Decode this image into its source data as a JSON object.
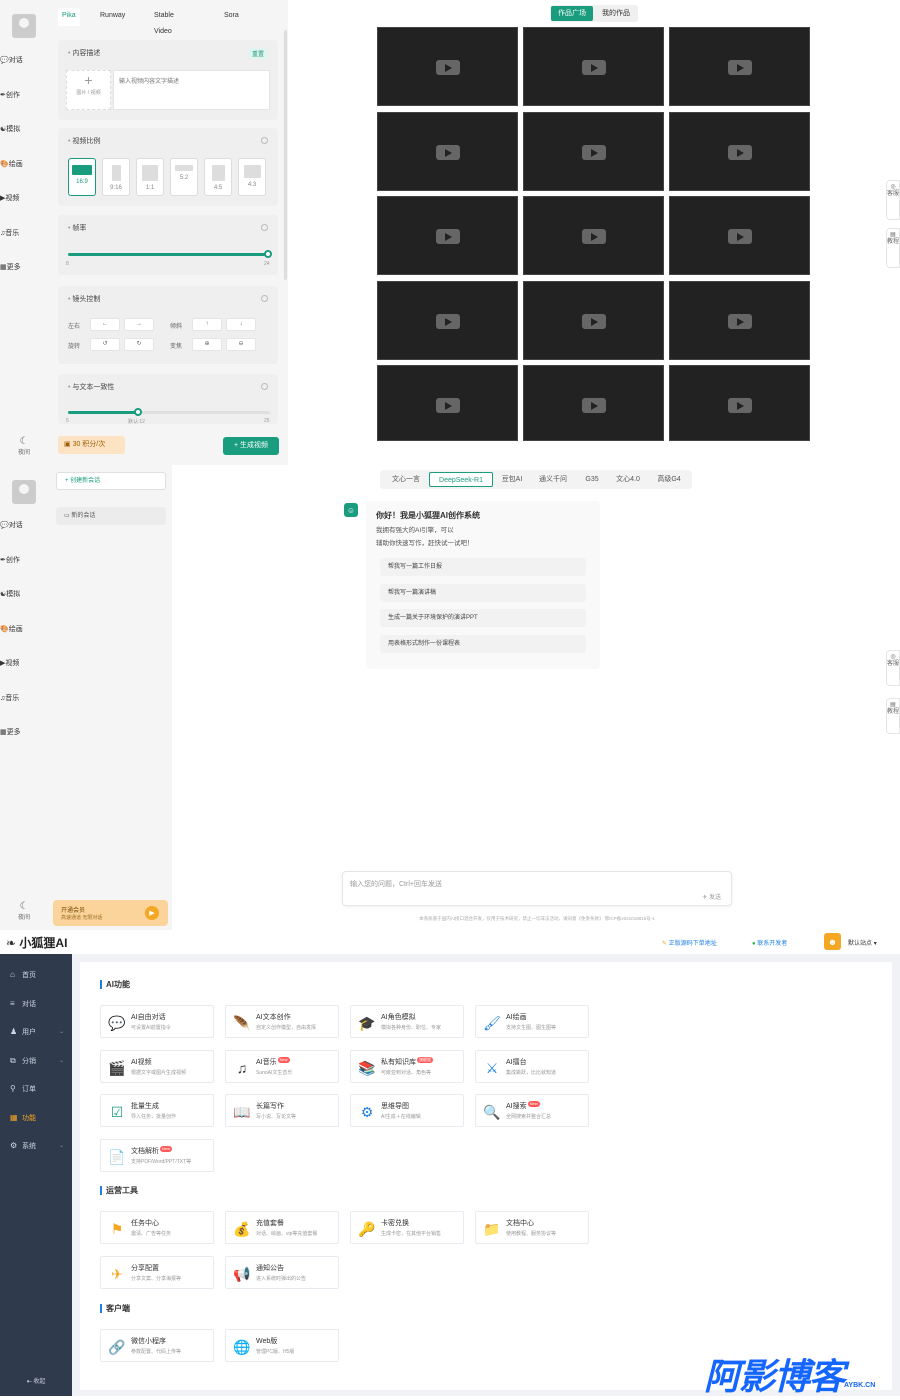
{
  "video_section": {
    "nav": [
      {
        "label": "对话",
        "icon": "chat-icon"
      },
      {
        "label": "创作",
        "icon": "feather-icon"
      },
      {
        "label": "模拟",
        "icon": "mask-icon"
      },
      {
        "label": "绘画",
        "icon": "palette-icon"
      },
      {
        "label": "视频",
        "icon": "video-icon"
      },
      {
        "label": "音乐",
        "icon": "music-icon"
      },
      {
        "label": "更多",
        "icon": "grid-icon"
      }
    ],
    "night_label": "夜间",
    "tabs": [
      "Pika",
      "Runway",
      "Stable Video",
      "Sora"
    ],
    "content_desc": {
      "title": "内容描述",
      "reset": "重置",
      "upload_label": "图片 / 视频",
      "placeholder": "输入视频内容文字描述"
    },
    "ratio": {
      "title": "视频比例",
      "options": [
        "16:9",
        "9:16",
        "1:1",
        "5:2",
        "4:5",
        "4:3"
      ]
    },
    "fps": {
      "title": "帧率",
      "min": "8",
      "max": "24",
      "value": 24
    },
    "camera": {
      "title": "镜头控制",
      "row1": [
        "左右",
        "倾斜"
      ],
      "row2": [
        "旋转",
        "变焦"
      ]
    },
    "consistency": {
      "title": "与文本一致性",
      "min": "5",
      "max": "25",
      "value": "默认:12"
    },
    "cost": "30 积分/次",
    "generate_button": "+ 生成视频",
    "gallery_tabs": [
      "作品广场",
      "我的作品"
    ],
    "side_buttons": [
      "客服",
      "教程"
    ]
  },
  "chat_section": {
    "new_chat": "+ 创建新会话",
    "session": "新的会话",
    "nav": [
      "对话",
      "创作",
      "模拟",
      "绘画",
      "视频",
      "音乐",
      "更多"
    ],
    "night_label": "夜间",
    "vip": {
      "title": "开通会员",
      "sub": "高速通道 无限对话"
    },
    "models": [
      "文心一言",
      "DeepSeek-R1",
      "豆包AI",
      "通义千问",
      "G35",
      "文心4.0",
      "高级G4"
    ],
    "greeting_title": "你好！我是小狐狸AI创作系统",
    "greeting_lines": [
      "我拥有强大的AI引擎，可以",
      "辅助你快速写作，赶快试一试吧！"
    ],
    "suggestions": [
      "帮我写一篇工作日报",
      "帮我写一篇演讲稿",
      "生成一篇关于环境保护的演讲PPT",
      "用表格形式制作一份课程表"
    ],
    "input_placeholder": "输入您的问题，Ctrl+回车发送",
    "send_label": "发送",
    "footer": "本系统基于国内AI接口混合开发，仅用于技术研究，禁止一切非法活动，请同意《免责条款》     鄂ICP备2021018815号-1",
    "side_buttons": [
      "客服",
      "教程"
    ]
  },
  "admin_section": {
    "logo": "小狐狸AI",
    "header_links": [
      "正版源码下单地址",
      "联系开发者"
    ],
    "user": "默认站点",
    "nav": [
      {
        "label": "首页",
        "icon": "home-icon"
      },
      {
        "label": "对话",
        "icon": "list-icon"
      },
      {
        "label": "用户",
        "icon": "user-icon",
        "chevron": true
      },
      {
        "label": "分销",
        "icon": "share-icon",
        "chevron": true
      },
      {
        "label": "订单",
        "icon": "order-icon"
      },
      {
        "label": "功能",
        "icon": "apps-icon"
      },
      {
        "label": "系统",
        "icon": "gear-icon",
        "chevron": true
      }
    ],
    "collapse": "收起",
    "sections": [
      {
        "title": "AI功能",
        "items": [
          {
            "t": "AI自由对话",
            "s": "可设置AI前置指令",
            "icon": "💬"
          },
          {
            "t": "AI文本创作",
            "s": "自定义创作模型，自由发挥",
            "icon": "🪶"
          },
          {
            "t": "AI角色模拟",
            "s": "模拟各种身份、职位、专家",
            "icon": "🎓"
          },
          {
            "t": "AI绘画",
            "s": "支持文生图、图生图等",
            "icon": "🖌"
          },
          {
            "t": "AI视频",
            "s": "根据文字或图片生成视频",
            "icon": "🎬"
          },
          {
            "t": "AI音乐",
            "s": "SunoAI文生音乐",
            "icon": "♫",
            "badge": "New"
          },
          {
            "t": "私有知识库",
            "s": "可嵌亚到对话、角色等",
            "icon": "📚",
            "badge": "旗舰版"
          },
          {
            "t": "AI擂台",
            "s": "集成跳跃，比比就知道",
            "icon": "⚔"
          },
          {
            "t": "批量生成",
            "s": "导入任务，批量创作",
            "icon": "☑"
          },
          {
            "t": "长篇写作",
            "s": "写小说、写论文等",
            "icon": "📖"
          },
          {
            "t": "思维导图",
            "s": "AI生成＋在线编辑",
            "icon": "⚙"
          },
          {
            "t": "AI搜索",
            "s": "全网搜索并整合汇总",
            "icon": "🔍",
            "badge": "New"
          },
          {
            "t": "文档解析",
            "s": "支持PDF/Word/PPT/TXT等",
            "icon": "📄",
            "badge": "New"
          }
        ]
      },
      {
        "title": "运营工具",
        "items": [
          {
            "t": "任务中心",
            "s": "邀请、广告等任务",
            "icon": "⚑"
          },
          {
            "t": "充值套餐",
            "s": "对话、绘画、vip等充值套餐",
            "icon": "💰"
          },
          {
            "t": "卡密兑换",
            "s": "生成卡密，在其他平台销售",
            "icon": "🔑"
          },
          {
            "t": "文档中心",
            "s": "使用教程、服务协议等",
            "icon": "📁"
          },
          {
            "t": "分享配置",
            "s": "分享文案、分享海报等",
            "icon": "✈"
          },
          {
            "t": "通知公告",
            "s": "进入系统时弹出的公告",
            "icon": "📢"
          }
        ]
      },
      {
        "title": "客户端",
        "items": [
          {
            "t": "微信小程序",
            "s": "参数配置、代码上传等",
            "icon": "🔗"
          },
          {
            "t": "Web版",
            "s": "管理PC版、H5版",
            "icon": "🌐"
          }
        ]
      }
    ],
    "watermark": "阿影博客",
    "watermark_sub": "AYBK.CN"
  }
}
